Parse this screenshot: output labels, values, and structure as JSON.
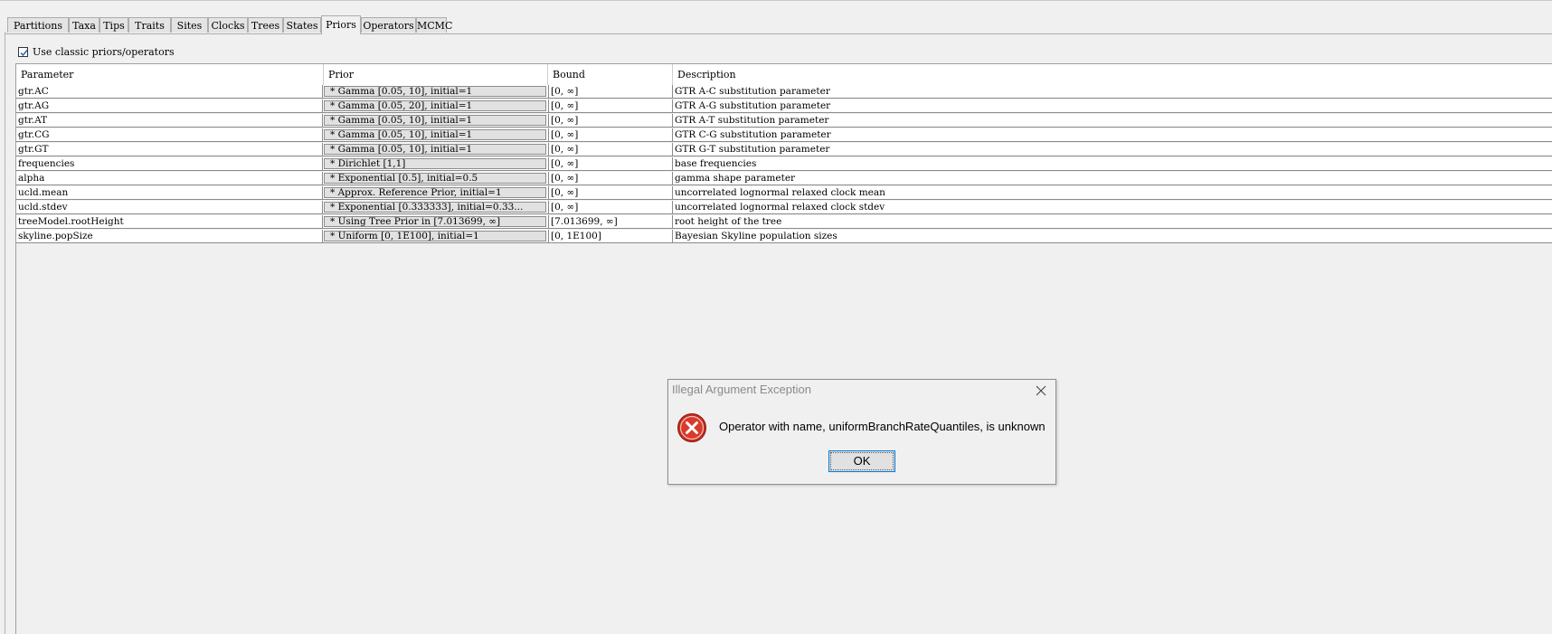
{
  "tabs": [
    "Partitions",
    "Taxa",
    "Tips",
    "Traits",
    "Sites",
    "Clocks",
    "Trees",
    "States",
    "Priors",
    "Operators",
    "MCMC"
  ],
  "active_tab": "Priors",
  "classic_checkbox": {
    "label": "Use classic priors/operators",
    "checked": true
  },
  "table": {
    "columns": [
      "Parameter",
      "Prior",
      "Bound",
      "Description"
    ],
    "rows": [
      {
        "parameter": "gtr.AC",
        "prior": "* Gamma [0.05, 10], initial=1",
        "bound": "[0, ∞]",
        "description": "GTR A-C substitution parameter"
      },
      {
        "parameter": "gtr.AG",
        "prior": "* Gamma [0.05, 20], initial=1",
        "bound": "[0, ∞]",
        "description": "GTR A-G substitution parameter"
      },
      {
        "parameter": "gtr.AT",
        "prior": "* Gamma [0.05, 10], initial=1",
        "bound": "[0, ∞]",
        "description": "GTR A-T substitution parameter"
      },
      {
        "parameter": "gtr.CG",
        "prior": "* Gamma [0.05, 10], initial=1",
        "bound": "[0, ∞]",
        "description": "GTR C-G substitution parameter"
      },
      {
        "parameter": "gtr.GT",
        "prior": "* Gamma [0.05, 10], initial=1",
        "bound": "[0, ∞]",
        "description": "GTR G-T substitution parameter"
      },
      {
        "parameter": "frequencies",
        "prior": "* Dirichlet [1,1]",
        "bound": "[0, ∞]",
        "description": "base frequencies"
      },
      {
        "parameter": "alpha",
        "prior": "* Exponential [0.5], initial=0.5",
        "bound": "[0, ∞]",
        "description": "gamma shape parameter"
      },
      {
        "parameter": "ucld.mean",
        "prior": "* Approx. Reference Prior, initial=1",
        "bound": "[0, ∞]",
        "description": "uncorrelated lognormal relaxed clock mean"
      },
      {
        "parameter": "ucld.stdev",
        "prior": "* Exponential [0.333333], initial=0.33...",
        "bound": "[0, ∞]",
        "description": "uncorrelated lognormal relaxed clock stdev"
      },
      {
        "parameter": "treeModel.rootHeight",
        "prior": "* Using Tree Prior in [7.013699, ∞]",
        "bound": "[7.013699, ∞]",
        "description": "root height of the tree"
      },
      {
        "parameter": "skyline.popSize",
        "prior": "* Uniform [0, 1E100], initial=1",
        "bound": "[0, 1E100]",
        "description": "Bayesian Skyline population sizes"
      }
    ]
  },
  "dialog": {
    "title": "Illegal Argument Exception",
    "icon": "error-icon",
    "message": "Operator with name, uniformBranchRateQuantiles, is unknown",
    "ok_label": "OK"
  }
}
